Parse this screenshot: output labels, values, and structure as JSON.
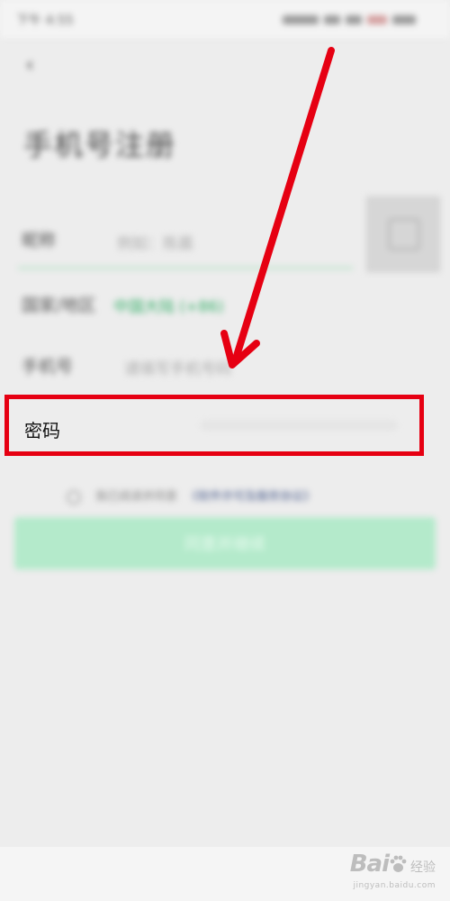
{
  "status_bar": {
    "time": "下午 4:55"
  },
  "header": {
    "back_icon": "back-arrow-icon",
    "title": "手机号注册"
  },
  "form": {
    "nickname_label": "昵称",
    "nickname_placeholder": "例如：陈晨",
    "region_label": "国家/地区",
    "region_value": "中国大陆 (+86)",
    "phone_label": "手机号",
    "phone_placeholder": "请填写手机号码",
    "password_label": "密码",
    "avatar_icon": "avatar-placeholder-icon"
  },
  "agreement": {
    "prefix": "我已阅读并同意",
    "link": "《软件许可及服务协议》"
  },
  "submit_label": "同意并继续",
  "annotation": {
    "color": "#e60012"
  },
  "watermark": {
    "brand_left": "Bai",
    "brand_right": "经验",
    "url": "jingyan.baidu.com"
  }
}
